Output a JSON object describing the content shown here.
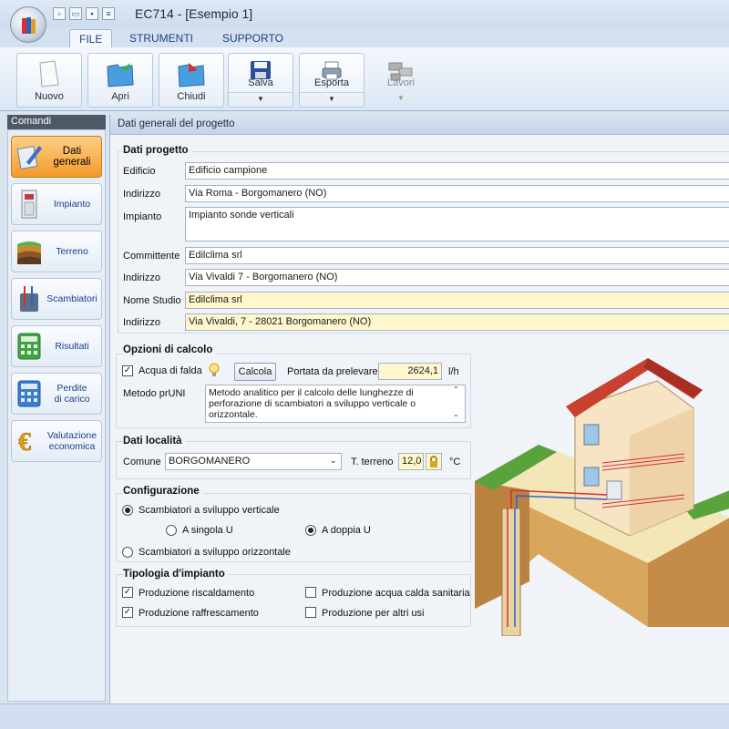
{
  "window": {
    "title": "EC714 - [Esempio 1]"
  },
  "ribbon": {
    "tabs": [
      {
        "label": "FILE"
      },
      {
        "label": "STRUMENTI"
      },
      {
        "label": "SUPPORTO"
      }
    ],
    "buttons": {
      "nuovo": "Nuovo",
      "apri": "Apri",
      "chiudi": "Chiudi",
      "salva": "Salva",
      "esporta": "Esporta",
      "lavori": "Lavori"
    }
  },
  "sidebar": {
    "header": "Comandi",
    "items": [
      {
        "label": "Dati generali",
        "icon": "edit-document-icon"
      },
      {
        "label": "Impianto",
        "icon": "heat-pump-icon"
      },
      {
        "label": "Terreno",
        "icon": "soil-layers-icon"
      },
      {
        "label": "Scambiatori",
        "icon": "exchanger-icon"
      },
      {
        "label": "Risultati",
        "icon": "calculator-icon"
      },
      {
        "label": "Perdite",
        "label2": "di carico",
        "icon": "pressure-calculator-icon"
      },
      {
        "label": "Valutazione",
        "label2": "economica",
        "icon": "euro-icon"
      }
    ]
  },
  "main": {
    "header": "Dati generali del progetto",
    "dati_progetto": {
      "title": "Dati progetto",
      "edificio_label": "Edificio",
      "edificio": "Edificio campione",
      "indirizzo_label": "Indirizzo",
      "indirizzo": "Via Roma - Borgomanero (NO)",
      "impianto_label": "Impianto",
      "impianto": "Impianto sonde verticali",
      "committente_label": "Committente",
      "committente": "Edilclima srl",
      "indirizzo2_label": "Indirizzo",
      "indirizzo2": "Via Vivaldi 7 - Borgomanero (NO)",
      "studio_label": "Nome Studio",
      "studio": "Edilclima srl",
      "indirizzo3_label": "Indirizzo",
      "indirizzo3": "Via Vivaldi, 7 - 28021 Borgomanero (NO)"
    },
    "opzioni": {
      "title": "Opzioni di calcolo",
      "falda_label": "Acqua di falda",
      "calcola": "Calcola",
      "portata_label": "Portata da prelevare",
      "portata": "2624,1",
      "portata_unit": "l/h",
      "metodo_label": "Metodo prUNI",
      "metodo": "Metodo analitico per il calcolo delle lunghezze di perforazione di scambiatori a sviluppo verticale o orizzontale."
    },
    "localita": {
      "title": "Dati località",
      "comune_label": "Comune",
      "comune": "BORGOMANERO",
      "terreno_label": "T. terreno",
      "terreno": "12,0",
      "terreno_unit": "°C"
    },
    "configurazione": {
      "title": "Configurazione",
      "verticale": "Scambiatori a sviluppo verticale",
      "singola": "A singola U",
      "doppia": "A doppia U",
      "orizzontale": "Scambiatori a sviluppo orizzontale"
    },
    "tipologia": {
      "title": "Tipologia d'impianto",
      "riscaldamento": "Produzione riscaldamento",
      "raffrescamento": "Produzione raffrescamento",
      "sanitaria": "Produzione acqua calda sanitaria",
      "altri": "Produzione per altri usi"
    }
  },
  "colors": {
    "accent": "#f39a2a",
    "ribbon_blue": "#1e3f80",
    "yellow_field": "#fff6cc"
  }
}
